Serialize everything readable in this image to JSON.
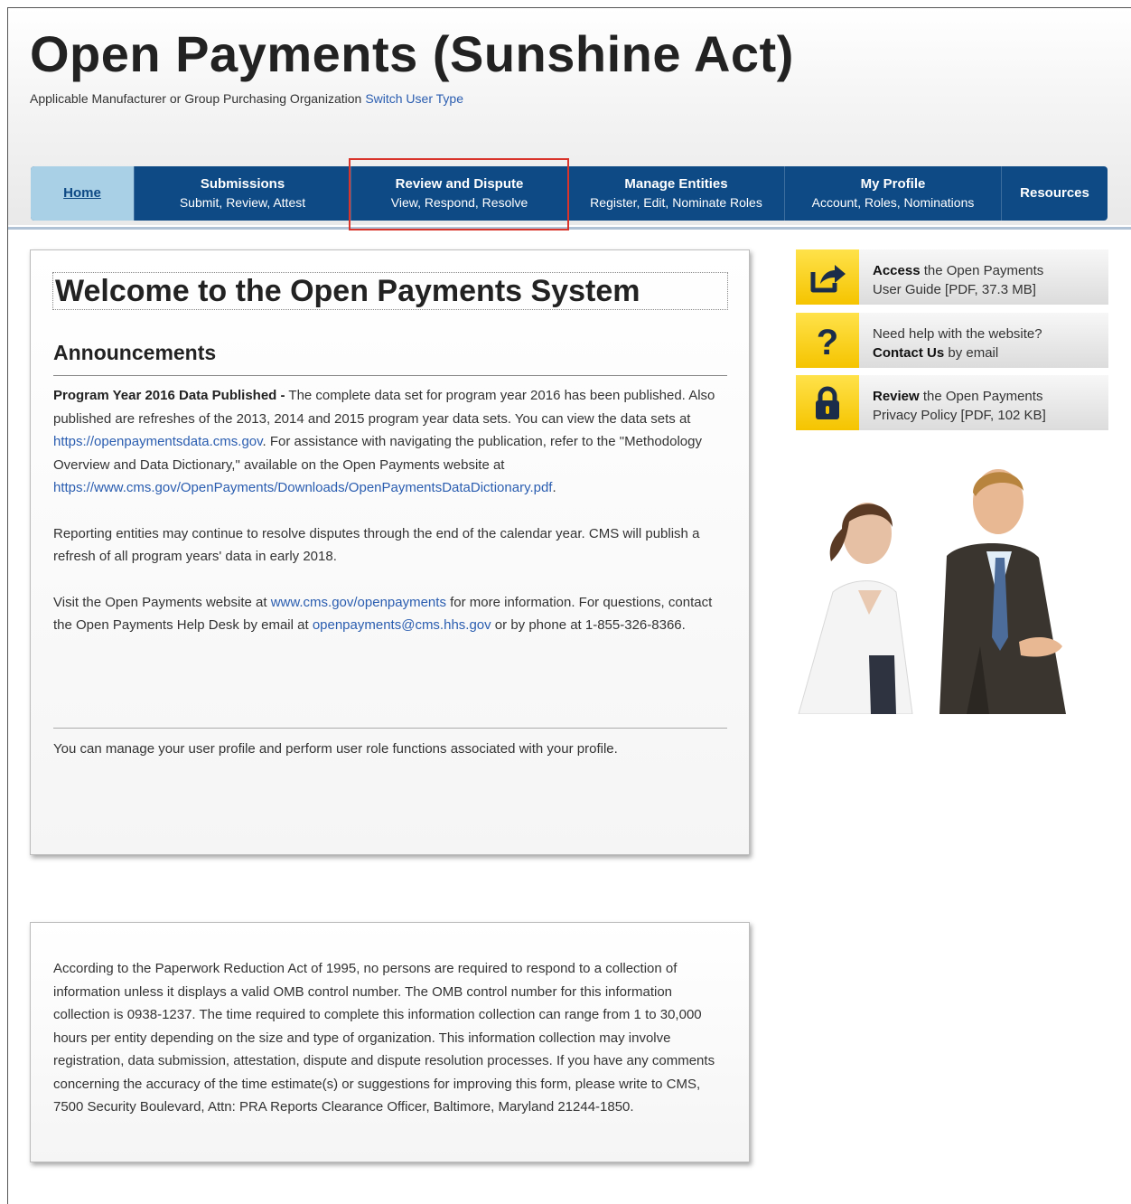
{
  "header": {
    "title": "Open Payments (Sunshine Act)",
    "user_type": "Applicable Manufacturer or Group Purchasing Organization",
    "switch_link": "Switch User Type"
  },
  "nav": {
    "home": "Home",
    "submissions": {
      "title": "Submissions",
      "sub": "Submit, Review, Attest"
    },
    "review": {
      "title": "Review and Dispute",
      "sub": "View, Respond, Resolve"
    },
    "entities": {
      "title": "Manage Entities",
      "sub": "Register, Edit, Nominate Roles"
    },
    "profile": {
      "title": "My Profile",
      "sub": "Account, Roles, Nominations"
    },
    "resources": "Resources"
  },
  "main": {
    "welcome": "Welcome to the Open Payments System",
    "announcements_title": "Announcements",
    "p1_bold": "Program Year 2016 Data Published -",
    "p1_a": " The complete data set for program year 2016 has been published. Also published are refreshes of the 2013, 2014 and 2015 program year data sets. You can view the data sets at ",
    "p1_link": "https://openpaymentsdata.cms.gov",
    "p1_b": ". For assistance with navigating the publication, refer to the \"Methodology Overview and Data Dictionary,\" available on the Open Payments website at",
    "p1_link2": "https://www.cms.gov/OpenPayments/Downloads/OpenPaymentsDataDictionary.pdf",
    "p1_c": ".",
    "p2": "Reporting entities may continue to resolve disputes through the end of the calendar year. CMS will publish a refresh of all program years' data in early 2018.",
    "p3_a": "Visit the Open Payments website at ",
    "p3_link": "www.cms.gov/openpayments",
    "p3_b": " for more information. For questions, contact the Open Payments Help Desk by email at ",
    "p3_link2": "openpayments@cms.hhs.gov",
    "p3_c": " or by phone at 1-855-326-8366.",
    "profile_text": "You can manage your user profile and perform user role functions associated with your profile."
  },
  "pra": {
    "text": "According to the Paperwork Reduction Act of 1995, no persons are required to respond to a collection of information unless it displays a valid OMB control number. The OMB control number for this information collection is 0938-1237. The time required to complete this information collection can range from 1 to 30,000 hours per entity depending on the size and type of organization. This information collection may involve registration, data submission, attestation, dispute and dispute resolution processes. If you have any comments concerning the accuracy of the time estimate(s) or suggestions for improving this form, please write to CMS, 7500 Security Boulevard, Attn: PRA Reports Clearance Officer, Baltimore, Maryland 21244-1850."
  },
  "sidebar": {
    "guide": {
      "bold": "Access",
      "rest": " the Open Payments",
      "line2": "User Guide [PDF, 37.3 MB]",
      "icon": "share-icon"
    },
    "help": {
      "line1": "Need help with the website?",
      "bold": "Contact Us",
      "rest": " by email",
      "icon": "question-icon"
    },
    "privacy": {
      "bold": "Review",
      "rest": " the Open Payments",
      "line2": "Privacy Policy [PDF, 102 KB]",
      "icon": "lock-icon"
    }
  },
  "colors": {
    "nav_bg": "#0e4a85",
    "home_tab": "#a9d0e6",
    "link": "#2a5db0",
    "icon_yellow": "#f5c400",
    "highlight": "#d9342b"
  }
}
